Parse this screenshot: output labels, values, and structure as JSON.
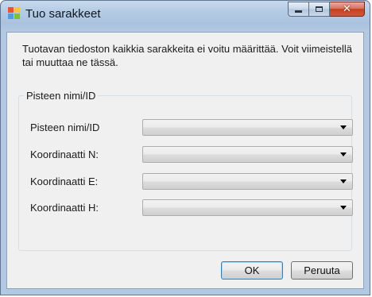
{
  "window": {
    "title": "Tuo sarakkeet",
    "icon": "app-window-icon",
    "controls": {
      "minimize": "minimize-icon",
      "maximize": "maximize-icon",
      "close": "close-icon"
    }
  },
  "message": "Tuotavan tiedoston kaikkia sarakkeita ei voitu määrittää. Voit viimeistellä tai muuttaa ne tässä.",
  "group": {
    "title": "Pisteen nimi/ID",
    "fields": [
      {
        "label": "Pisteen nimi/ID",
        "value": ""
      },
      {
        "label": "Koordinaatti N:",
        "value": ""
      },
      {
        "label": "Koordinaatti E:",
        "value": ""
      },
      {
        "label": "Koordinaatti H:",
        "value": ""
      }
    ]
  },
  "buttons": {
    "ok": "OK",
    "cancel": "Peruuta"
  },
  "colors": {
    "title_bar": "#b7cde6",
    "client": "#f0f0f0",
    "close_button": "#c7401f",
    "default_button_border": "#3c7fb1"
  }
}
